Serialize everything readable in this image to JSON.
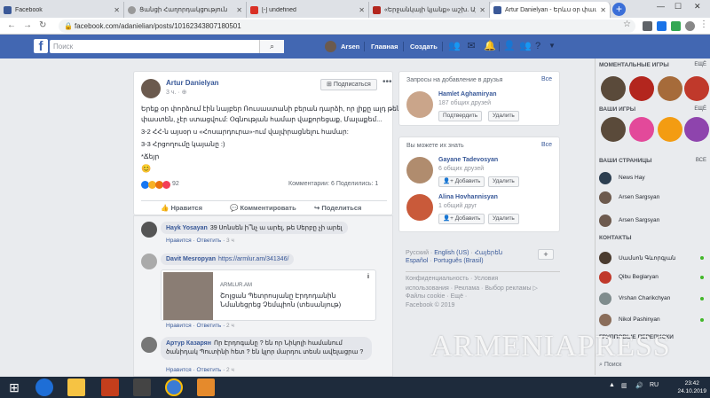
{
  "browser": {
    "tabs": [
      {
        "title": "Facebook",
        "color": "#3b5998"
      },
      {
        "title": "Ցանցի Հաղորդակցություն",
        "color": "#888888"
      },
      {
        "title": "[-] undefined",
        "color": "#d93025"
      },
      {
        "title": "«Երջանկայի կյանք» աշխ. Աշխա...",
        "color": "#b3261e"
      },
      {
        "title": "Artur Danielyan - Երևս օր փաստ...",
        "color": "#3b5998"
      }
    ],
    "url": "facebook.com/adanielian/posts/10162343807180501"
  },
  "fb": {
    "search_placeholder": "Поиск",
    "user": "Arsen",
    "home": "Главная",
    "create": "Создать"
  },
  "post": {
    "author": "Artur Danielyan",
    "time": "3 ч.",
    "subscribe": "Подписаться",
    "lines": [
      "Երեք օր փորձում էին նայբեր Ռուսաստանի բերան դարձի, որ լիքը ալդ թենն",
      "փաստեն, չէր ստացվում: Օգնության համար վաքորեցաք, Մալաքեմ...",
      "3-2 ՀՀ-ն այսօր ս «Հոսարդուրա»-ում վալփրացնելու համար:",
      "3-3 Հրցողումը կայանը :)",
      "*Ճեյր"
    ],
    "reaction_count": "92",
    "comments_shares": "Комментарии: 6  Поделились: 1",
    "like": "Нравится",
    "comment": "Комментировать",
    "share": "Поделиться"
  },
  "comments": [
    {
      "name": "Hayk Yosayan",
      "text": "39 Սոնսեն ի՞նչ ա արել, թե Սերբը չի արել",
      "like": "Нравится",
      "reply": "Ответить",
      "time": "3 ч"
    },
    {
      "name": "Davit Mesropyan",
      "text": "https://armlur.am/341346/",
      "link_source": "ARMLUR.AM",
      "link_title": "Շոլցան Պետրոսյանը Էրդոդանին Նմանեցրեց Չեմպիոն (տեսանյութ)",
      "like": "Нравится",
      "reply": "Ответить",
      "time": "2 ч"
    },
    {
      "name": "Артур Казарян",
      "text": "Որ Էրդոգանը ? են որ Նիկոլի համանում ծանիդակ Պուտինի հետ ? են կլոր մարդու տեսն ավելացրա ?",
      "like": "Нравится",
      "reply": "Ответить",
      "time": "2 ч"
    }
  ],
  "friend_requests": {
    "title": "Запросы на добавление в друзья",
    "all": "Все",
    "items": [
      {
        "name": "Hamlet Aghamiryan",
        "mutual": "187 общих друзей",
        "confirm": "Подтвердить",
        "delete": "Удалить"
      }
    ]
  },
  "pymk": {
    "title": "Вы можете их знать",
    "all": "Все",
    "items": [
      {
        "name": "Gayane Tadevosyan",
        "mutual": "6 общих друзей",
        "add": "Добавить",
        "delete": "Удалить"
      },
      {
        "name": "Alina Hovhannisyan",
        "mutual": "1 общий друг",
        "add": "Добавить",
        "delete": "Удалить"
      }
    ]
  },
  "languages": [
    "Русский",
    "English (US)",
    "Հայերեն",
    "Español",
    "Português (Brasil)"
  ],
  "footer": [
    "Конфиденциальность · Условия",
    "использования · Реклама · Выбор рекламы ▷",
    "Файлы cookie · Ещё ·",
    "Facebook © 2019"
  ],
  "chat": {
    "games_title": "МОМЕНТАЛЬНЫЕ ИГРЫ",
    "games_all": "ЕЩЁ",
    "your_games": "ВАШИ ИГРЫ",
    "your_games_all": "ЕЩЁ",
    "pages_title": "ВАШИ СТРАНИЦЫ",
    "pages_all": "ВСЕ",
    "pages": [
      "News Hay",
      "Arsen Sargsyan",
      "Arsen Sargsyan"
    ],
    "contacts_title": "КОНТАКТЫ",
    "contacts": [
      "Սամսոն Գևորգյան",
      "Qibu Beglaryan",
      "Vrshan Charikchyan",
      "Nikol Pashinyan"
    ],
    "groups_title": "ГРУППОВЫЕ ПЕРЕПИСКИ",
    "search": "Поиск"
  },
  "taskbar": {
    "time": "23:42",
    "date": "24.10.2019",
    "lang": "RU"
  },
  "watermark": "ARMENIAPRESS"
}
